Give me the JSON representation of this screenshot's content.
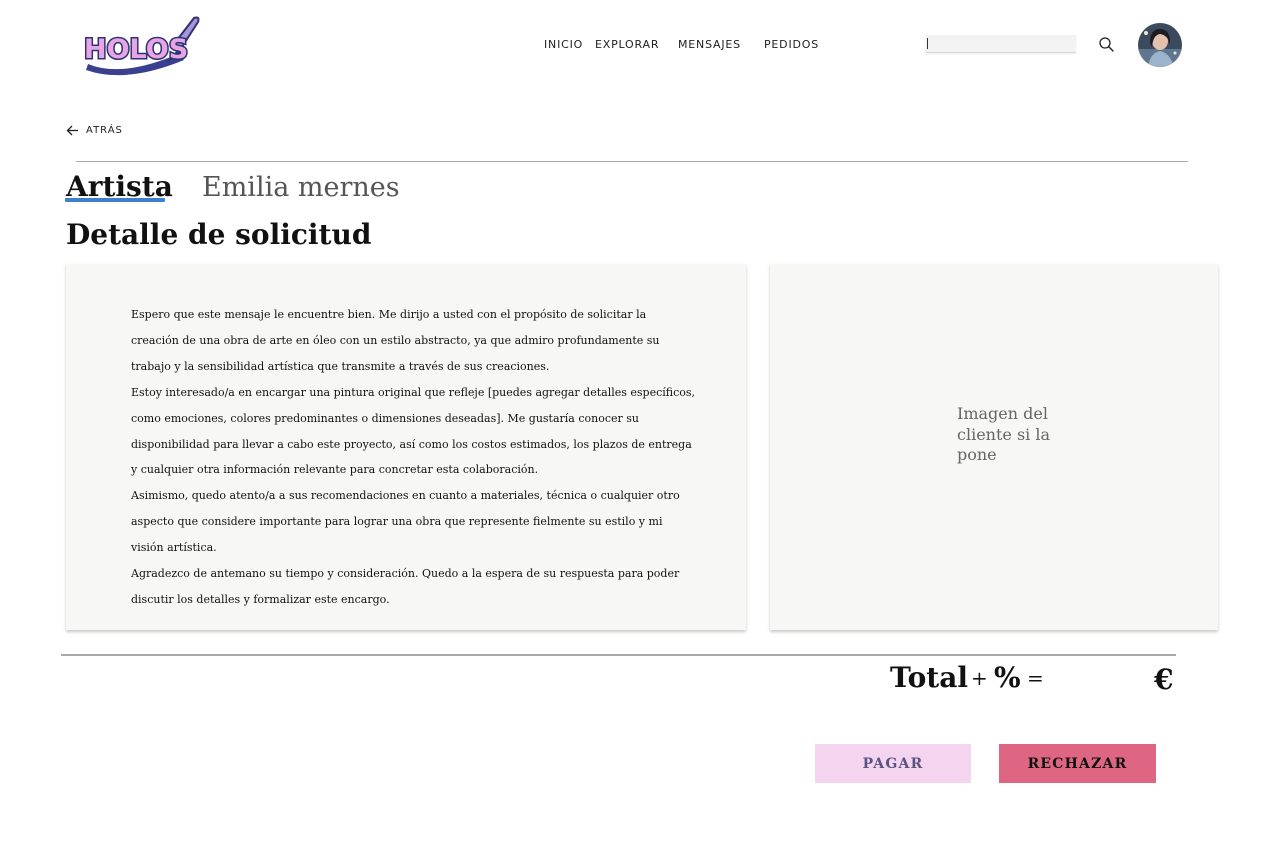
{
  "header": {
    "logo_text": "HOLOS",
    "nav": [
      {
        "label": "INICIO"
      },
      {
        "label": "EXPLORAR"
      },
      {
        "label": "MENSAJES"
      },
      {
        "label": "PEDIDOS"
      }
    ],
    "search": {
      "value": "",
      "placeholder": ""
    },
    "icons": {
      "search": "search-icon",
      "avatar": "user-avatar"
    }
  },
  "back": {
    "label": "ATRÁS",
    "icon": "arrow-left-icon"
  },
  "profile": {
    "tab_label": "Artista",
    "artist_name": "Emilia mernes"
  },
  "section_title": "Detalle de solicitud",
  "request": {
    "paragraphs": [
      "Espero que este mensaje le encuentre bien. Me dirijo a usted con el propósito de solicitar la creación de una obra de arte en óleo con un estilo abstracto, ya que admiro profundamente su trabajo y la sensibilidad artística que transmite a través de sus creaciones.",
      "Estoy interesado/a en encargar una pintura original que refleje [puedes agregar detalles específicos, como emociones, colores predominantes o dimensiones deseadas]. Me gustaría conocer su disponibilidad para llevar a cabo este proyecto, así como los costos estimados, los plazos de entrega y cualquier otra información relevante para concretar esta colaboración.",
      "Asimismo, quedo atento/a a sus recomendaciones en cuanto a materiales, técnica o cualquier otro aspecto que considere importante para lograr una obra que represente fielmente su estilo y mi visión artística.",
      "Agradezco de antemano su tiempo y consideración. Quedo a la espera de su respuesta para poder discutir los detalles y formalizar este encargo."
    ],
    "image_placeholder": "Imagen del cliente si la pone"
  },
  "total": {
    "label": "Total",
    "plus": "+",
    "percent": "%",
    "equals": "=",
    "currency": "€"
  },
  "actions": {
    "pay_label": "PAGAR",
    "reject_label": "RECHAZAR"
  },
  "colors": {
    "accent_underline": "#3e7fd0",
    "pay_bg": "#f5d4ef",
    "pay_text": "#5b5380",
    "reject_bg": "#df6683",
    "panel_bg": "#f7f7f5"
  }
}
